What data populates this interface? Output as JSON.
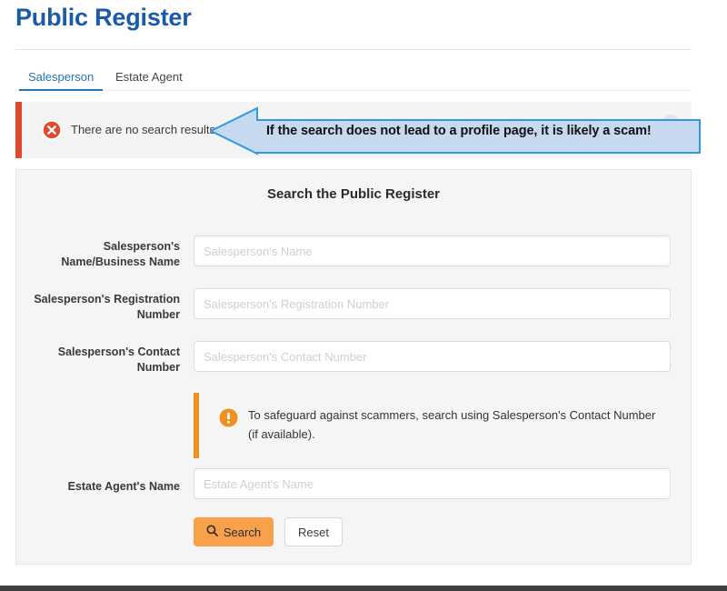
{
  "header": {
    "title": "Public Register"
  },
  "tabs": [
    {
      "id": "salesperson",
      "label": "Salesperson",
      "active": true
    },
    {
      "id": "estate-agent",
      "label": "Estate Agent",
      "active": false
    }
  ],
  "alert": {
    "icon": "error-circle-icon",
    "message": "There are no search results",
    "close_label": "×",
    "accent_color": "#e0492c"
  },
  "annotation": {
    "text": "If the search does not lead to a profile page, it is likely a scam!",
    "fill_color": "#c6d9ef",
    "border_color": "#2e9bdf",
    "shape": "left-arrow-callout"
  },
  "form": {
    "title": "Search the Public Register",
    "fields": [
      {
        "id": "salesperson-name",
        "label": "Salesperson's Name/Business Name",
        "placeholder": "Salesperson's Name",
        "value": ""
      },
      {
        "id": "salesperson-registration-number",
        "label": "Salesperson's Registration Number",
        "placeholder": "Salesperson's Registration Number",
        "value": ""
      },
      {
        "id": "salesperson-contact-number",
        "label": "Salesperson's Contact Number",
        "placeholder": "Salesperson's Contact Number",
        "value": ""
      },
      {
        "id": "estate-agent-name",
        "label": "Estate Agent's Name",
        "placeholder": "Estate Agent's Name",
        "value": ""
      }
    ],
    "note": {
      "icon": "exclamation-circle-icon",
      "text": "To safeguard against scammers, search using Salesperson's Contact Number (if available).",
      "accent_color": "#f0901e"
    },
    "buttons": {
      "search_label": "Search",
      "search_icon": "search-icon",
      "search_color": "#f8a14a",
      "reset_label": "Reset"
    }
  }
}
